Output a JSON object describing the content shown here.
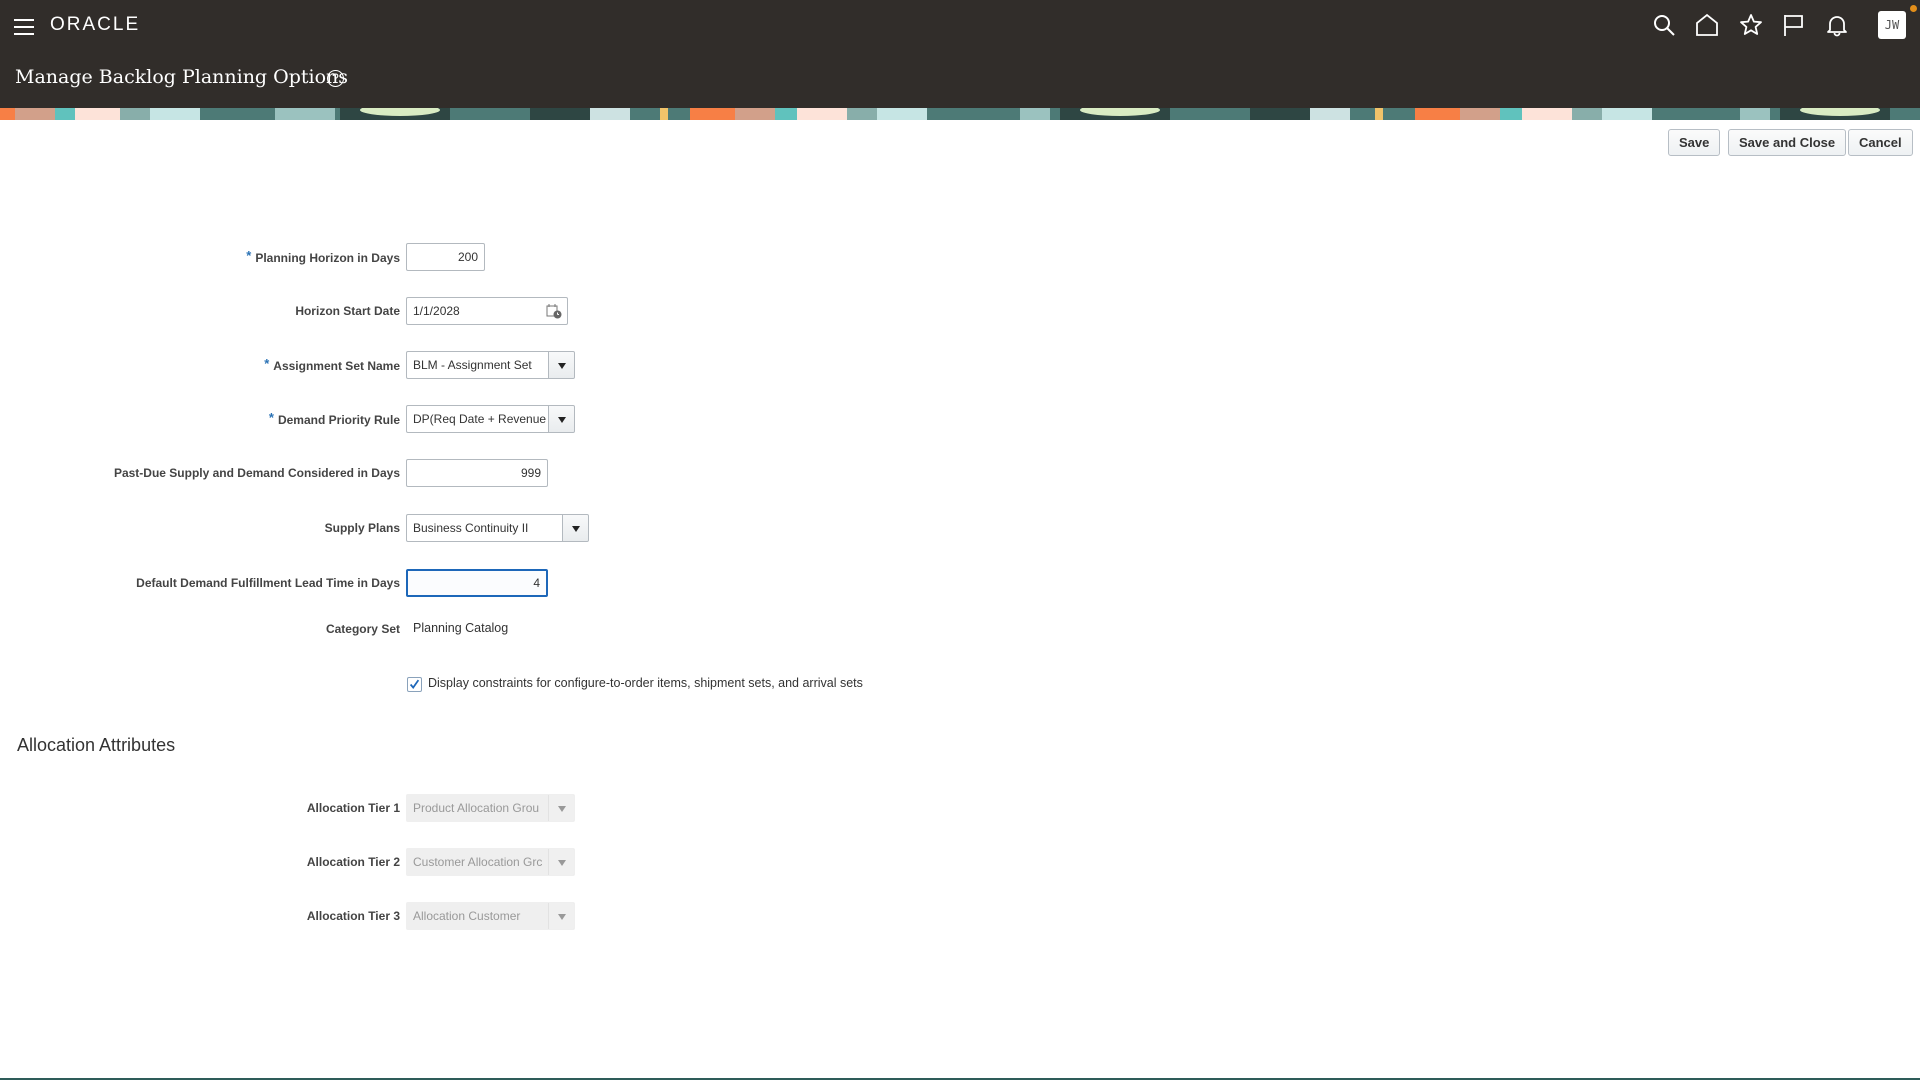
{
  "header": {
    "logo": "ORACLE",
    "page_title": "Manage Backlog Planning Options",
    "help_icon": "?",
    "icons": [
      "menu-icon",
      "search-icon",
      "home-icon",
      "favorites-star-icon",
      "flag-icon",
      "notifications-bell-icon"
    ],
    "avatar_initials": "JW"
  },
  "toolbar": {
    "save_label": "Save",
    "save_and_close_label": "Save and Close",
    "cancel_label": "Cancel"
  },
  "form": {
    "planning_horizon": {
      "label": "Planning Horizon in Days",
      "required": true,
      "value": "200"
    },
    "horizon_start_date": {
      "label": "Horizon Start Date",
      "value": "1/1/2028"
    },
    "assignment_set_name": {
      "label": "Assignment Set Name",
      "required": true,
      "value": "BLM - Assignment Set"
    },
    "demand_priority_rule": {
      "label": "Demand Priority Rule",
      "required": true,
      "value": "DP(Req Date + Revenue"
    },
    "past_due": {
      "label": "Past-Due Supply and Demand Considered in Days",
      "value": "999"
    },
    "supply_plans": {
      "label": "Supply Plans",
      "value": "Business Continuity II"
    },
    "default_lead_time": {
      "label": "Default Demand Fulfillment Lead Time in Days",
      "value": "4"
    },
    "category_set": {
      "label": "Category Set",
      "value": "Planning Catalog"
    },
    "display_constraints": {
      "label": "Display constraints for configure-to-order items, shipment sets, and arrival sets",
      "checked": true
    }
  },
  "allocation": {
    "section_title": "Allocation Attributes",
    "tiers": [
      {
        "label": "Allocation Tier 1",
        "value": "Product Allocation Grou"
      },
      {
        "label": "Allocation Tier 2",
        "value": "Customer Allocation Grc"
      },
      {
        "label": "Allocation Tier 3",
        "value": "Allocation Customer"
      }
    ]
  },
  "colors": {
    "header_bg": "#312d2a",
    "required_star": "#2a72b5",
    "focus_border": "#1d67b9",
    "notification_dot": "#e38e1a"
  }
}
